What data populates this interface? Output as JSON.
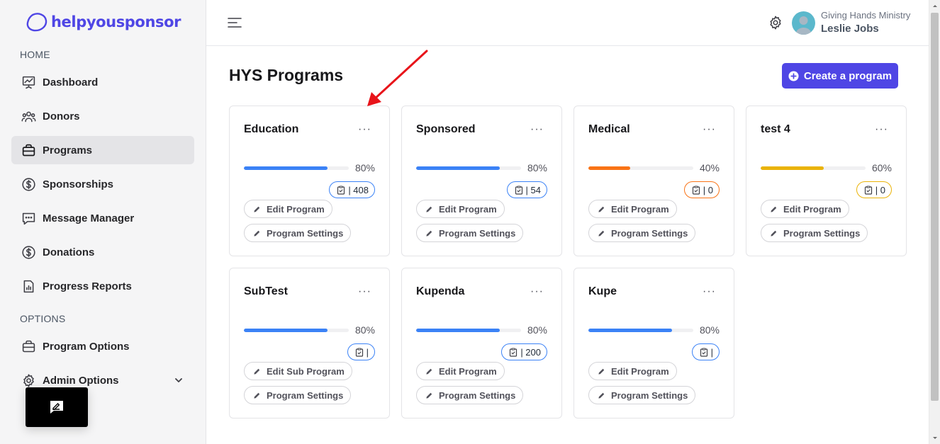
{
  "brand": {
    "name": "helpyousponsor",
    "color": "#4f46e5"
  },
  "sidebar": {
    "home_label": "HOME",
    "options_label": "OPTIONS",
    "items": [
      {
        "label": "Dashboard",
        "icon": "presentation-chart-icon"
      },
      {
        "label": "Donors",
        "icon": "users-icon"
      },
      {
        "label": "Programs",
        "icon": "briefcase-icon",
        "active": true
      },
      {
        "label": "Sponsorships",
        "icon": "dollar-circle-icon"
      },
      {
        "label": "Message Manager",
        "icon": "message-icon"
      },
      {
        "label": "Donations",
        "icon": "dollar-circle-icon"
      },
      {
        "label": "Progress Reports",
        "icon": "report-icon"
      }
    ],
    "option_items": [
      {
        "label": "Program Options",
        "icon": "briefcase-icon"
      },
      {
        "label": "Admin Options",
        "icon": "gear-icon"
      }
    ]
  },
  "header": {
    "org": "Giving Hands Ministry",
    "user": "Leslie Jobs"
  },
  "main": {
    "title": "HYS Programs",
    "create_label": "Create a program"
  },
  "programs": [
    {
      "name": "Education",
      "percent": 80,
      "percent_label": "80%",
      "count": "| 408",
      "color": "#3b82f6",
      "edit_label": "Edit Program",
      "settings_label": "Program Settings"
    },
    {
      "name": "Sponsored",
      "percent": 80,
      "percent_label": "80%",
      "count": "| 54",
      "color": "#3b82f6",
      "edit_label": "Edit Program",
      "settings_label": "Program Settings"
    },
    {
      "name": "Medical",
      "percent": 40,
      "percent_label": "40%",
      "count": "| 0",
      "color": "#f97316",
      "edit_label": "Edit Program",
      "settings_label": "Program Settings"
    },
    {
      "name": "test 4",
      "percent": 60,
      "percent_label": "60%",
      "count": "| 0",
      "color": "#eab308",
      "edit_label": "Edit Program",
      "settings_label": "Program Settings"
    },
    {
      "name": "SubTest",
      "percent": 80,
      "percent_label": "80%",
      "count": "|",
      "color": "#3b82f6",
      "edit_label": "Edit Sub Program",
      "settings_label": "Program Settings"
    },
    {
      "name": "Kupenda",
      "percent": 80,
      "percent_label": "80%",
      "count": "| 200",
      "color": "#3b82f6",
      "edit_label": "Edit Program",
      "settings_label": "Program Settings"
    },
    {
      "name": "Kupe",
      "percent": 80,
      "percent_label": "80%",
      "count": "|",
      "color": "#3b82f6",
      "edit_label": "Edit Program",
      "settings_label": "Program Settings"
    }
  ]
}
